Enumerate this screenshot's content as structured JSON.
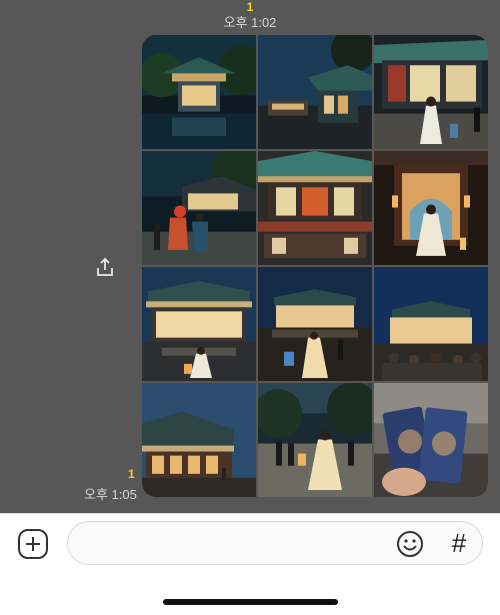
{
  "chat": {
    "top_unread": "1",
    "top_time": "오후 1:02",
    "bottom_unread": "1",
    "bottom_time": "오후 1:05"
  },
  "photo_grid": {
    "photos": [
      {
        "subject": "pavilion-night"
      },
      {
        "subject": "palace-roof-night"
      },
      {
        "subject": "hanbok-woman-palace"
      },
      {
        "subject": "couple-hanbok-night"
      },
      {
        "subject": "pavilion-balcony-lanterns"
      },
      {
        "subject": "gate-woman-lantern"
      },
      {
        "subject": "main-hall-night"
      },
      {
        "subject": "hall-lantern-woman"
      },
      {
        "subject": "hall-crowd"
      },
      {
        "subject": "palace-corner-dusk"
      },
      {
        "subject": "woman-lantern-path"
      },
      {
        "subject": "tickets-hand"
      }
    ]
  },
  "input": {
    "placeholder": "",
    "value": ""
  },
  "icons": {
    "share": "share-icon",
    "plus": "plus-icon",
    "emoji": "emoji-icon",
    "hash": "#"
  },
  "colors": {
    "chat_background": "#575757",
    "unread_count": "#f3d21b",
    "timestamp": "#d8d8d8",
    "input_bar": "#ffffff"
  }
}
